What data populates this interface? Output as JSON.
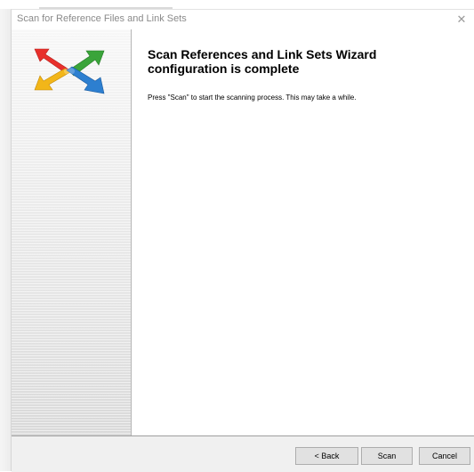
{
  "window": {
    "title": "Scan for Reference Files and Link Sets",
    "close_glyph": "✕"
  },
  "content": {
    "heading": "Scan References and Link Sets Wizard configuration is complete",
    "description": "Press \"Scan\" to start the scanning process. This may take a while."
  },
  "buttons": {
    "back": "< Back",
    "scan": "Scan",
    "cancel": "Cancel"
  },
  "logo": {
    "icon": "four-way-arrows-icon",
    "colors": [
      "#e8302c",
      "#3aa43a",
      "#f2b619",
      "#2d7fd0"
    ]
  }
}
